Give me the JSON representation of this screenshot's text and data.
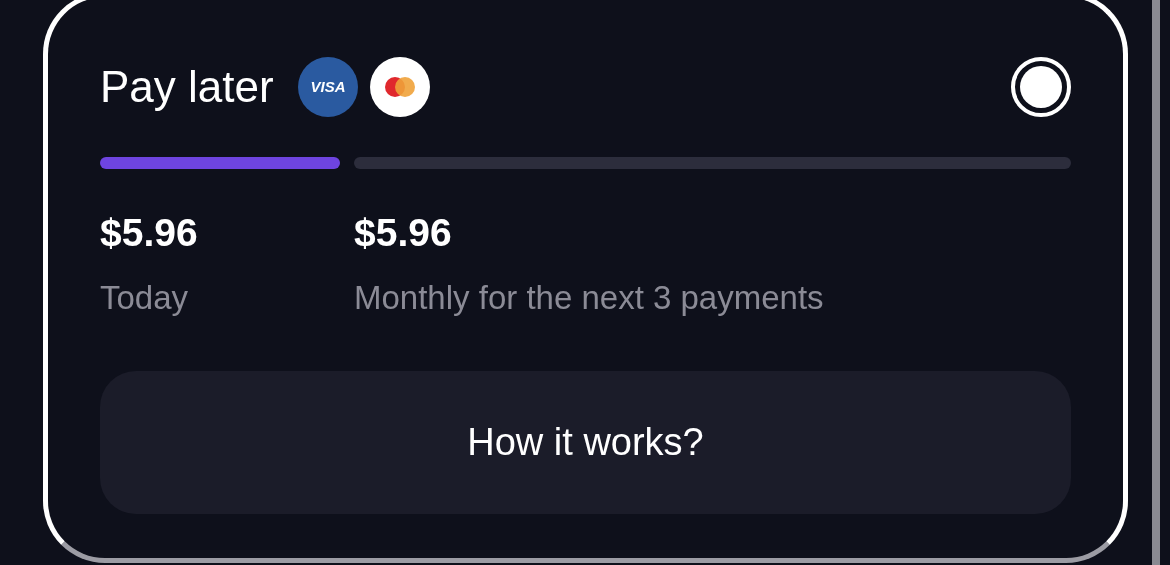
{
  "option": {
    "title": "Pay later",
    "card_logo": "VISA",
    "selected": true,
    "installments": [
      {
        "amount": "$5.96",
        "label": "Today",
        "paid": true
      },
      {
        "amount": "$5.96",
        "label": "Monthly for the next 3 payments",
        "paid": false
      }
    ],
    "button": "How it works?"
  }
}
